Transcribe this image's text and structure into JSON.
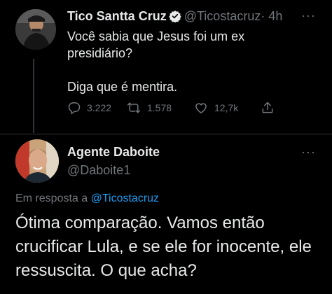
{
  "tweet1": {
    "author_name": "Tico Santta Cruz",
    "author_handle": "@Ticostacruz",
    "time": "· 4h",
    "more": "···",
    "text_line1": "Você sabia que Jesus foi um ex presidiário?",
    "text_line2": "Diga que é mentira.",
    "replies": "3.222",
    "retweets": "1.578",
    "likes": "12,7k",
    "icons": [
      "reply-icon",
      "retweet-icon",
      "like-icon",
      "share-icon",
      "verified-badge-icon"
    ]
  },
  "tweet2": {
    "author_name": "Agente Daboite",
    "author_handle": "@Daboite1",
    "more": "···",
    "reply_prefix": "Em resposta a",
    "reply_mention": "@Ticostacruz",
    "text": "Ótima comparação. Vamos então crucificar Lula, e se ele for inocente, ele ressuscita. O que acha?"
  },
  "colors": {
    "background": "#000000",
    "text": "#e7e9ea",
    "muted": "#71767b",
    "accent": "#1d9bf0",
    "divider": "#2f3336"
  }
}
